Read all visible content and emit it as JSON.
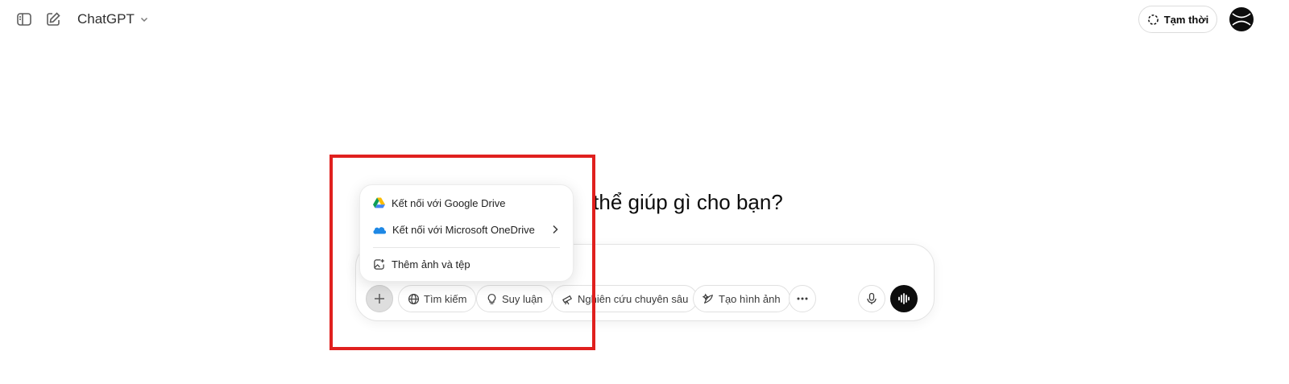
{
  "header": {
    "model_name": "ChatGPT",
    "temporary_label": "Tạm thời"
  },
  "hero": {
    "title_visible": "thể giúp gì cho bạn?"
  },
  "attach_menu": {
    "items": [
      {
        "label": "Kết nối với Google Drive",
        "icon": "google-drive-icon"
      },
      {
        "label": "Kết nối với Microsoft OneDrive",
        "icon": "onedrive-icon",
        "has_submenu": true
      },
      {
        "label": "Thêm ảnh và tệp",
        "icon": "add-image-icon"
      }
    ]
  },
  "composer": {
    "tools": [
      {
        "label": "Tìm kiếm",
        "icon": "globe-icon"
      },
      {
        "label": "Suy luận",
        "icon": "lightbulb-icon"
      },
      {
        "label": "Nghiên cứu chuyên sâu",
        "icon": "telescope-icon"
      },
      {
        "label": "Tạo hình ảnh",
        "icon": "image-sparkle-icon"
      }
    ]
  },
  "colors": {
    "highlight": "#e0201e",
    "plus_active_bg": "#dedede",
    "voice_button": "#0d0d0d"
  }
}
